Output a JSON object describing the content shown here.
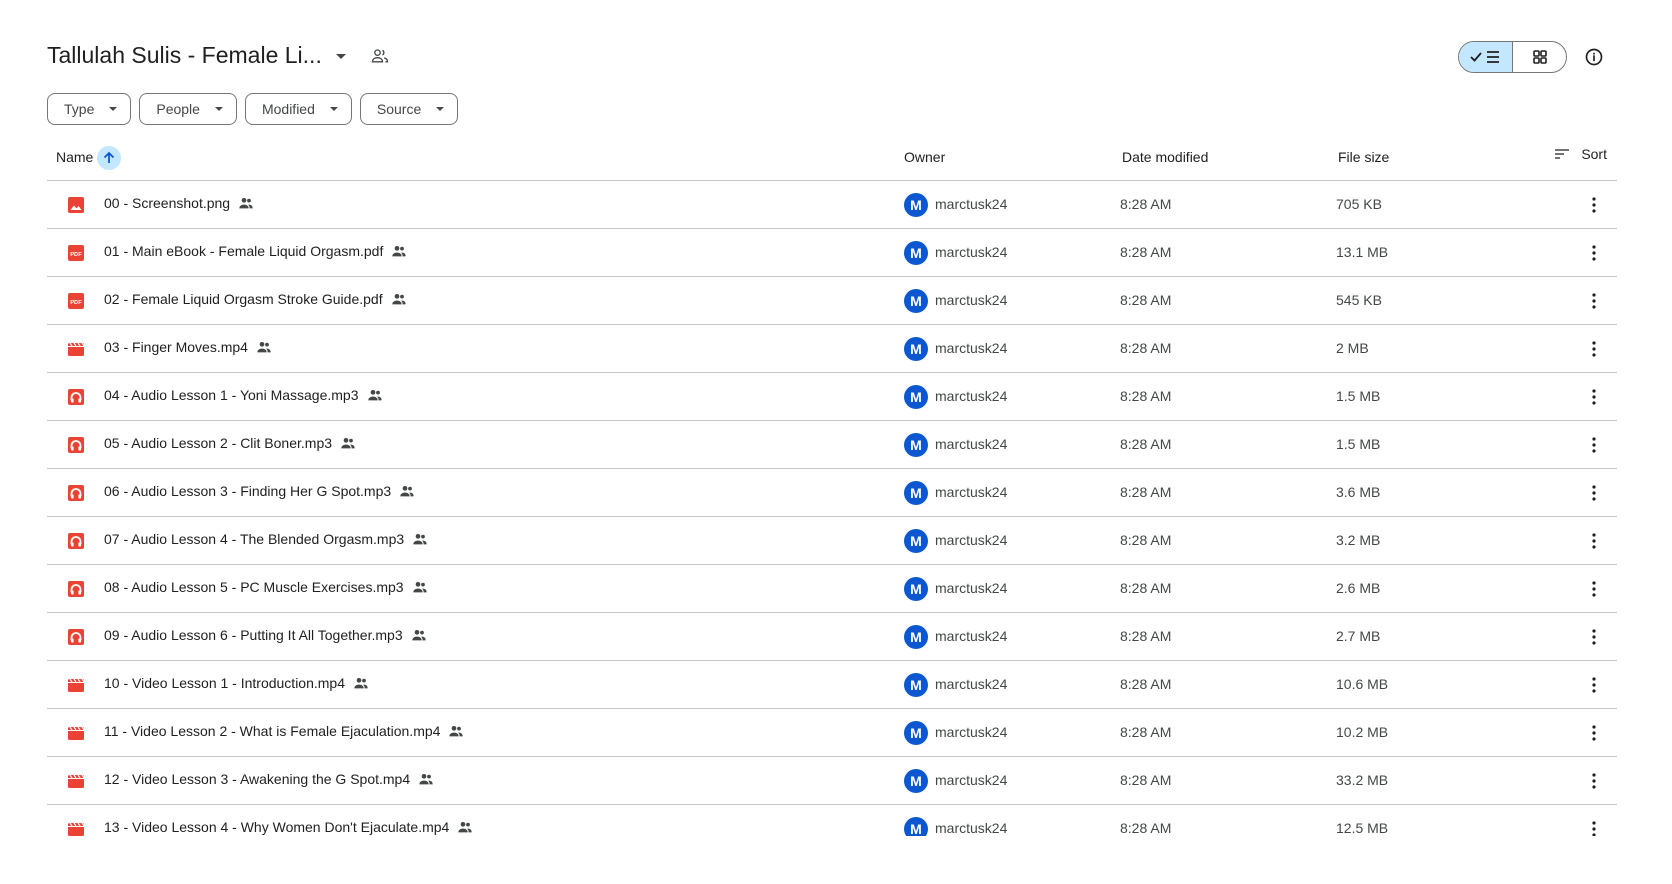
{
  "header": {
    "title": "Tallulah Sulis - Female Li...",
    "title_caret_icon": "arrow-drop-down-icon",
    "shared_icon": "shared-people-icon",
    "view_list_icon": "list-view-icon",
    "view_grid_icon": "grid-view-icon",
    "info_icon": "info-icon"
  },
  "filters": [
    {
      "label": "Type"
    },
    {
      "label": "People"
    },
    {
      "label": "Modified"
    },
    {
      "label": "Source"
    }
  ],
  "columns": {
    "name": "Name",
    "owner": "Owner",
    "date": "Date modified",
    "size": "File size",
    "sort": "Sort"
  },
  "colors": {
    "accent": "#c2e7ff",
    "file_red": "#ea4335",
    "avatar_blue": "#0b57d0"
  },
  "files": [
    {
      "type": "image",
      "name": "00 - Screenshot.png",
      "owner_initial": "M",
      "owner": "marctusk24",
      "date": "8:28 AM",
      "size": "705 KB"
    },
    {
      "type": "pdf",
      "name": "01 - Main eBook - Female Liquid Orgasm.pdf",
      "owner_initial": "M",
      "owner": "marctusk24",
      "date": "8:28 AM",
      "size": "13.1 MB"
    },
    {
      "type": "pdf",
      "name": "02 - Female Liquid Orgasm Stroke Guide.pdf",
      "owner_initial": "M",
      "owner": "marctusk24",
      "date": "8:28 AM",
      "size": "545 KB"
    },
    {
      "type": "video",
      "name": "03 - Finger Moves.mp4",
      "owner_initial": "M",
      "owner": "marctusk24",
      "date": "8:28 AM",
      "size": "2 MB"
    },
    {
      "type": "audio",
      "name": "04 - Audio Lesson 1 - Yoni Massage.mp3",
      "owner_initial": "M",
      "owner": "marctusk24",
      "date": "8:28 AM",
      "size": "1.5 MB"
    },
    {
      "type": "audio",
      "name": "05 - Audio Lesson 2 - Clit Boner.mp3",
      "owner_initial": "M",
      "owner": "marctusk24",
      "date": "8:28 AM",
      "size": "1.5 MB"
    },
    {
      "type": "audio",
      "name": "06 - Audio Lesson 3 - Finding Her G Spot.mp3",
      "owner_initial": "M",
      "owner": "marctusk24",
      "date": "8:28 AM",
      "size": "3.6 MB"
    },
    {
      "type": "audio",
      "name": "07 - Audio Lesson 4 - The Blended Orgasm.mp3",
      "owner_initial": "M",
      "owner": "marctusk24",
      "date": "8:28 AM",
      "size": "3.2 MB"
    },
    {
      "type": "audio",
      "name": "08 - Audio Lesson 5 - PC Muscle Exercises.mp3",
      "owner_initial": "M",
      "owner": "marctusk24",
      "date": "8:28 AM",
      "size": "2.6 MB"
    },
    {
      "type": "audio",
      "name": "09 - Audio Lesson 6 - Putting It All Together.mp3",
      "owner_initial": "M",
      "owner": "marctusk24",
      "date": "8:28 AM",
      "size": "2.7 MB"
    },
    {
      "type": "video",
      "name": "10 - Video Lesson 1 - Introduction.mp4",
      "owner_initial": "M",
      "owner": "marctusk24",
      "date": "8:28 AM",
      "size": "10.6 MB"
    },
    {
      "type": "video",
      "name": "11 - Video Lesson 2 - What is Female Ejaculation.mp4",
      "owner_initial": "M",
      "owner": "marctusk24",
      "date": "8:28 AM",
      "size": "10.2 MB"
    },
    {
      "type": "video",
      "name": "12 - Video Lesson 3 - Awakening the G Spot.mp4",
      "owner_initial": "M",
      "owner": "marctusk24",
      "date": "8:28 AM",
      "size": "33.2 MB"
    },
    {
      "type": "video",
      "name": "13 - Video Lesson 4 - Why Women Don't Ejaculate.mp4",
      "owner_initial": "M",
      "owner": "marctusk24",
      "date": "8:28 AM",
      "size": "12.5 MB"
    }
  ]
}
